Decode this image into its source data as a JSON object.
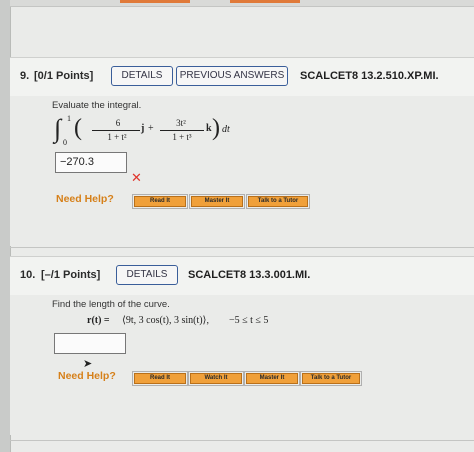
{
  "q9": {
    "number": "9.",
    "points": "[0/1 Points]",
    "details_label": "DETAILS",
    "previous_answers_label": "PREVIOUS ANSWERS",
    "code": "SCALCET8 13.2.510.XP.MI.",
    "prompt": "Evaluate the integral.",
    "integral_upper": "1",
    "integral_lower": "0",
    "term1_num": "6",
    "term1_den": "1 + t²",
    "term1_vec": "j",
    "plus": "+",
    "term2_num": "3t²",
    "term2_den": "1 + t³",
    "term2_vec": "k",
    "dt": "dt",
    "answer": "−270.3",
    "need_help": "Need Help?",
    "help_buttons": [
      "Read It",
      "Master It",
      "Talk to a Tutor"
    ]
  },
  "q10": {
    "number": "10.",
    "points": "[–/1 Points]",
    "details_label": "DETAILS",
    "code": "SCALCET8 13.3.001.MI.",
    "prompt": "Find the length of the curve.",
    "curve_lhs": "r(t) = ",
    "curve_rhs": "⟨9t, 3 cos(t), 3 sin(t)⟩,",
    "range": "−5 ≤ t ≤ 5",
    "answer": "",
    "need_help": "Need Help?",
    "help_buttons": [
      "Read It",
      "Watch It",
      "Master It",
      "Talk to a Tutor"
    ]
  },
  "colors": {
    "accent_button_border": "#3a5e9a",
    "help_button": "#f0a03a",
    "error_mark": "#e0352c",
    "need_help_text": "#d6801a"
  }
}
